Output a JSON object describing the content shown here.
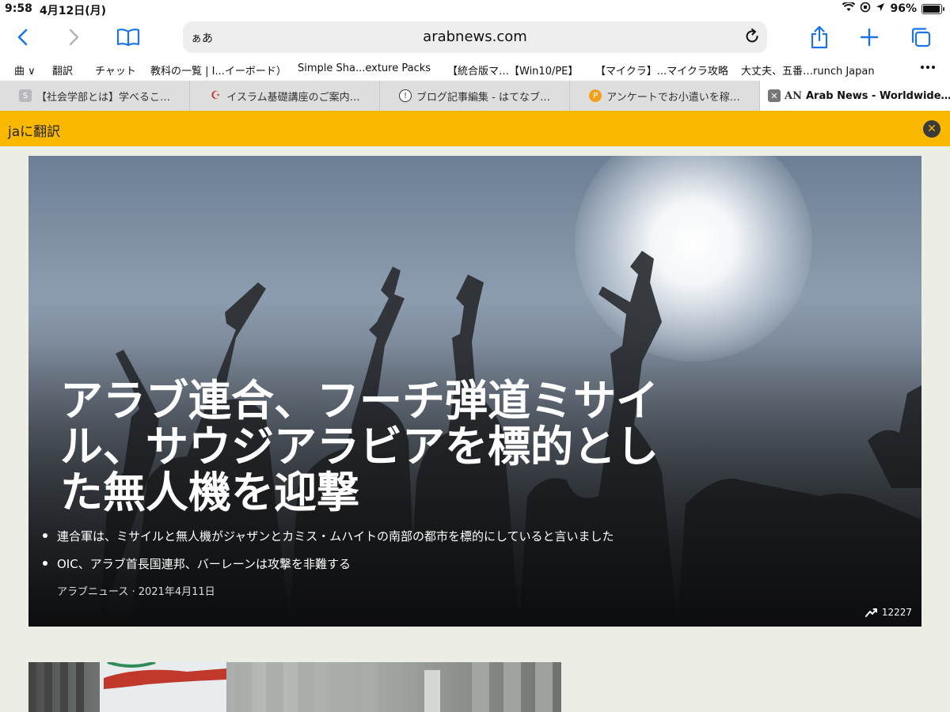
{
  "status_bar": {
    "time": "9:58",
    "date": "4月12日(月)",
    "battery_text": "96%",
    "battery_level": 0.96
  },
  "toolbar": {
    "reader_label": "ぁあ",
    "url": "arabnews.com"
  },
  "bookmarks": [
    {
      "label": "曲 ∨"
    },
    {
      "label": "翻訳"
    },
    {
      "label": "チャット"
    },
    {
      "label": "教科の一覧 | I...イーボード）"
    },
    {
      "label": "Simple Sha...exture Packs"
    },
    {
      "label": "【統合版マ…【Win10/PE】"
    },
    {
      "label": "【マイクラ】...マイクラ攻略"
    },
    {
      "label": "大丈夫、五番…runch Japan"
    }
  ],
  "tabs": [
    {
      "title": "【社会学部とは】学べるこ…",
      "icon": "S",
      "color": "#b8b8bd"
    },
    {
      "title": "イスラム基礎講座のご案内…",
      "icon": "☪",
      "color": "#c0392b"
    },
    {
      "title": "ブログ記事編集 - はてなブ…",
      "icon": "!",
      "color": "#333333"
    },
    {
      "title": "アンケートでお小遣いを稼…",
      "icon": "P",
      "color": "#f1a11a"
    },
    {
      "title": "Arab News - Worldwide…",
      "icon": "AN",
      "color": "#ffffff",
      "active": true
    }
  ],
  "translate_banner": {
    "label": "jaに翻訳"
  },
  "article": {
    "headline": "アラブ連合、フーチ弾道ミサイル、サウジアラビアを標的とした無人機を迎撃",
    "bullets": [
      "連合軍は、ミサイルと無人機がジャザンとカミス・ムハイトの南部の都市を標的にしていると言いました",
      "OIC、アラブ首長国連邦、バーレーンは攻撃を非難する"
    ],
    "byline": "アラブニュース · 2021年4月11日",
    "views": "12227"
  }
}
